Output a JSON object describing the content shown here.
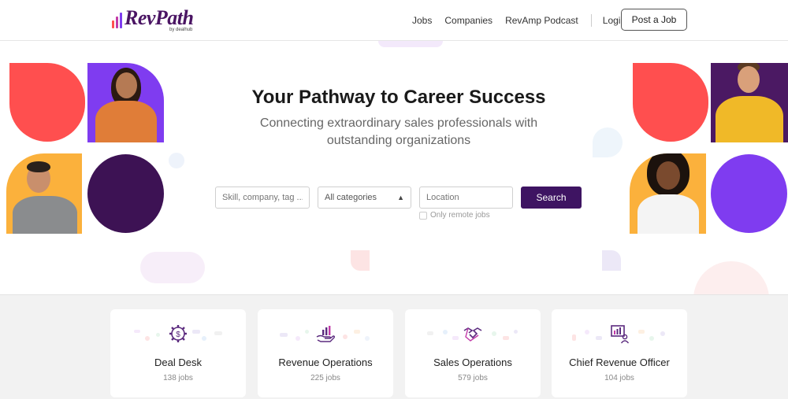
{
  "brand": {
    "name": "RevPath",
    "sub": "by dealhub"
  },
  "nav": {
    "links": [
      "Jobs",
      "Companies",
      "RevAmp Podcast"
    ],
    "login": "Login",
    "post_job": "Post a Job"
  },
  "hero": {
    "title": "Your Pathway to Career Success",
    "subtitle": "Connecting extraordinary sales professionals with outstanding organizations"
  },
  "search": {
    "keyword_placeholder": "Skill, company, tag ...",
    "category_value": "All categories",
    "location_placeholder": "Location",
    "button": "Search",
    "remote_label": "Only remote jobs"
  },
  "categories": [
    {
      "title": "Deal Desk",
      "count": "138 jobs",
      "icon": "gear-dollar-icon"
    },
    {
      "title": "Revenue Operations",
      "count": "225 jobs",
      "icon": "chart-hand-icon"
    },
    {
      "title": "Sales Operations",
      "count": "579 jobs",
      "icon": "handshake-icon"
    },
    {
      "title": "Chief Revenue Officer",
      "count": "104 jobs",
      "icon": "presentation-icon"
    }
  ],
  "colors": {
    "brand_purple": "#3e1462",
    "coral": "#ff4f4f",
    "violet": "#7f3cf0",
    "deep_purple": "#4b1963",
    "amber": "#fbb13c"
  }
}
